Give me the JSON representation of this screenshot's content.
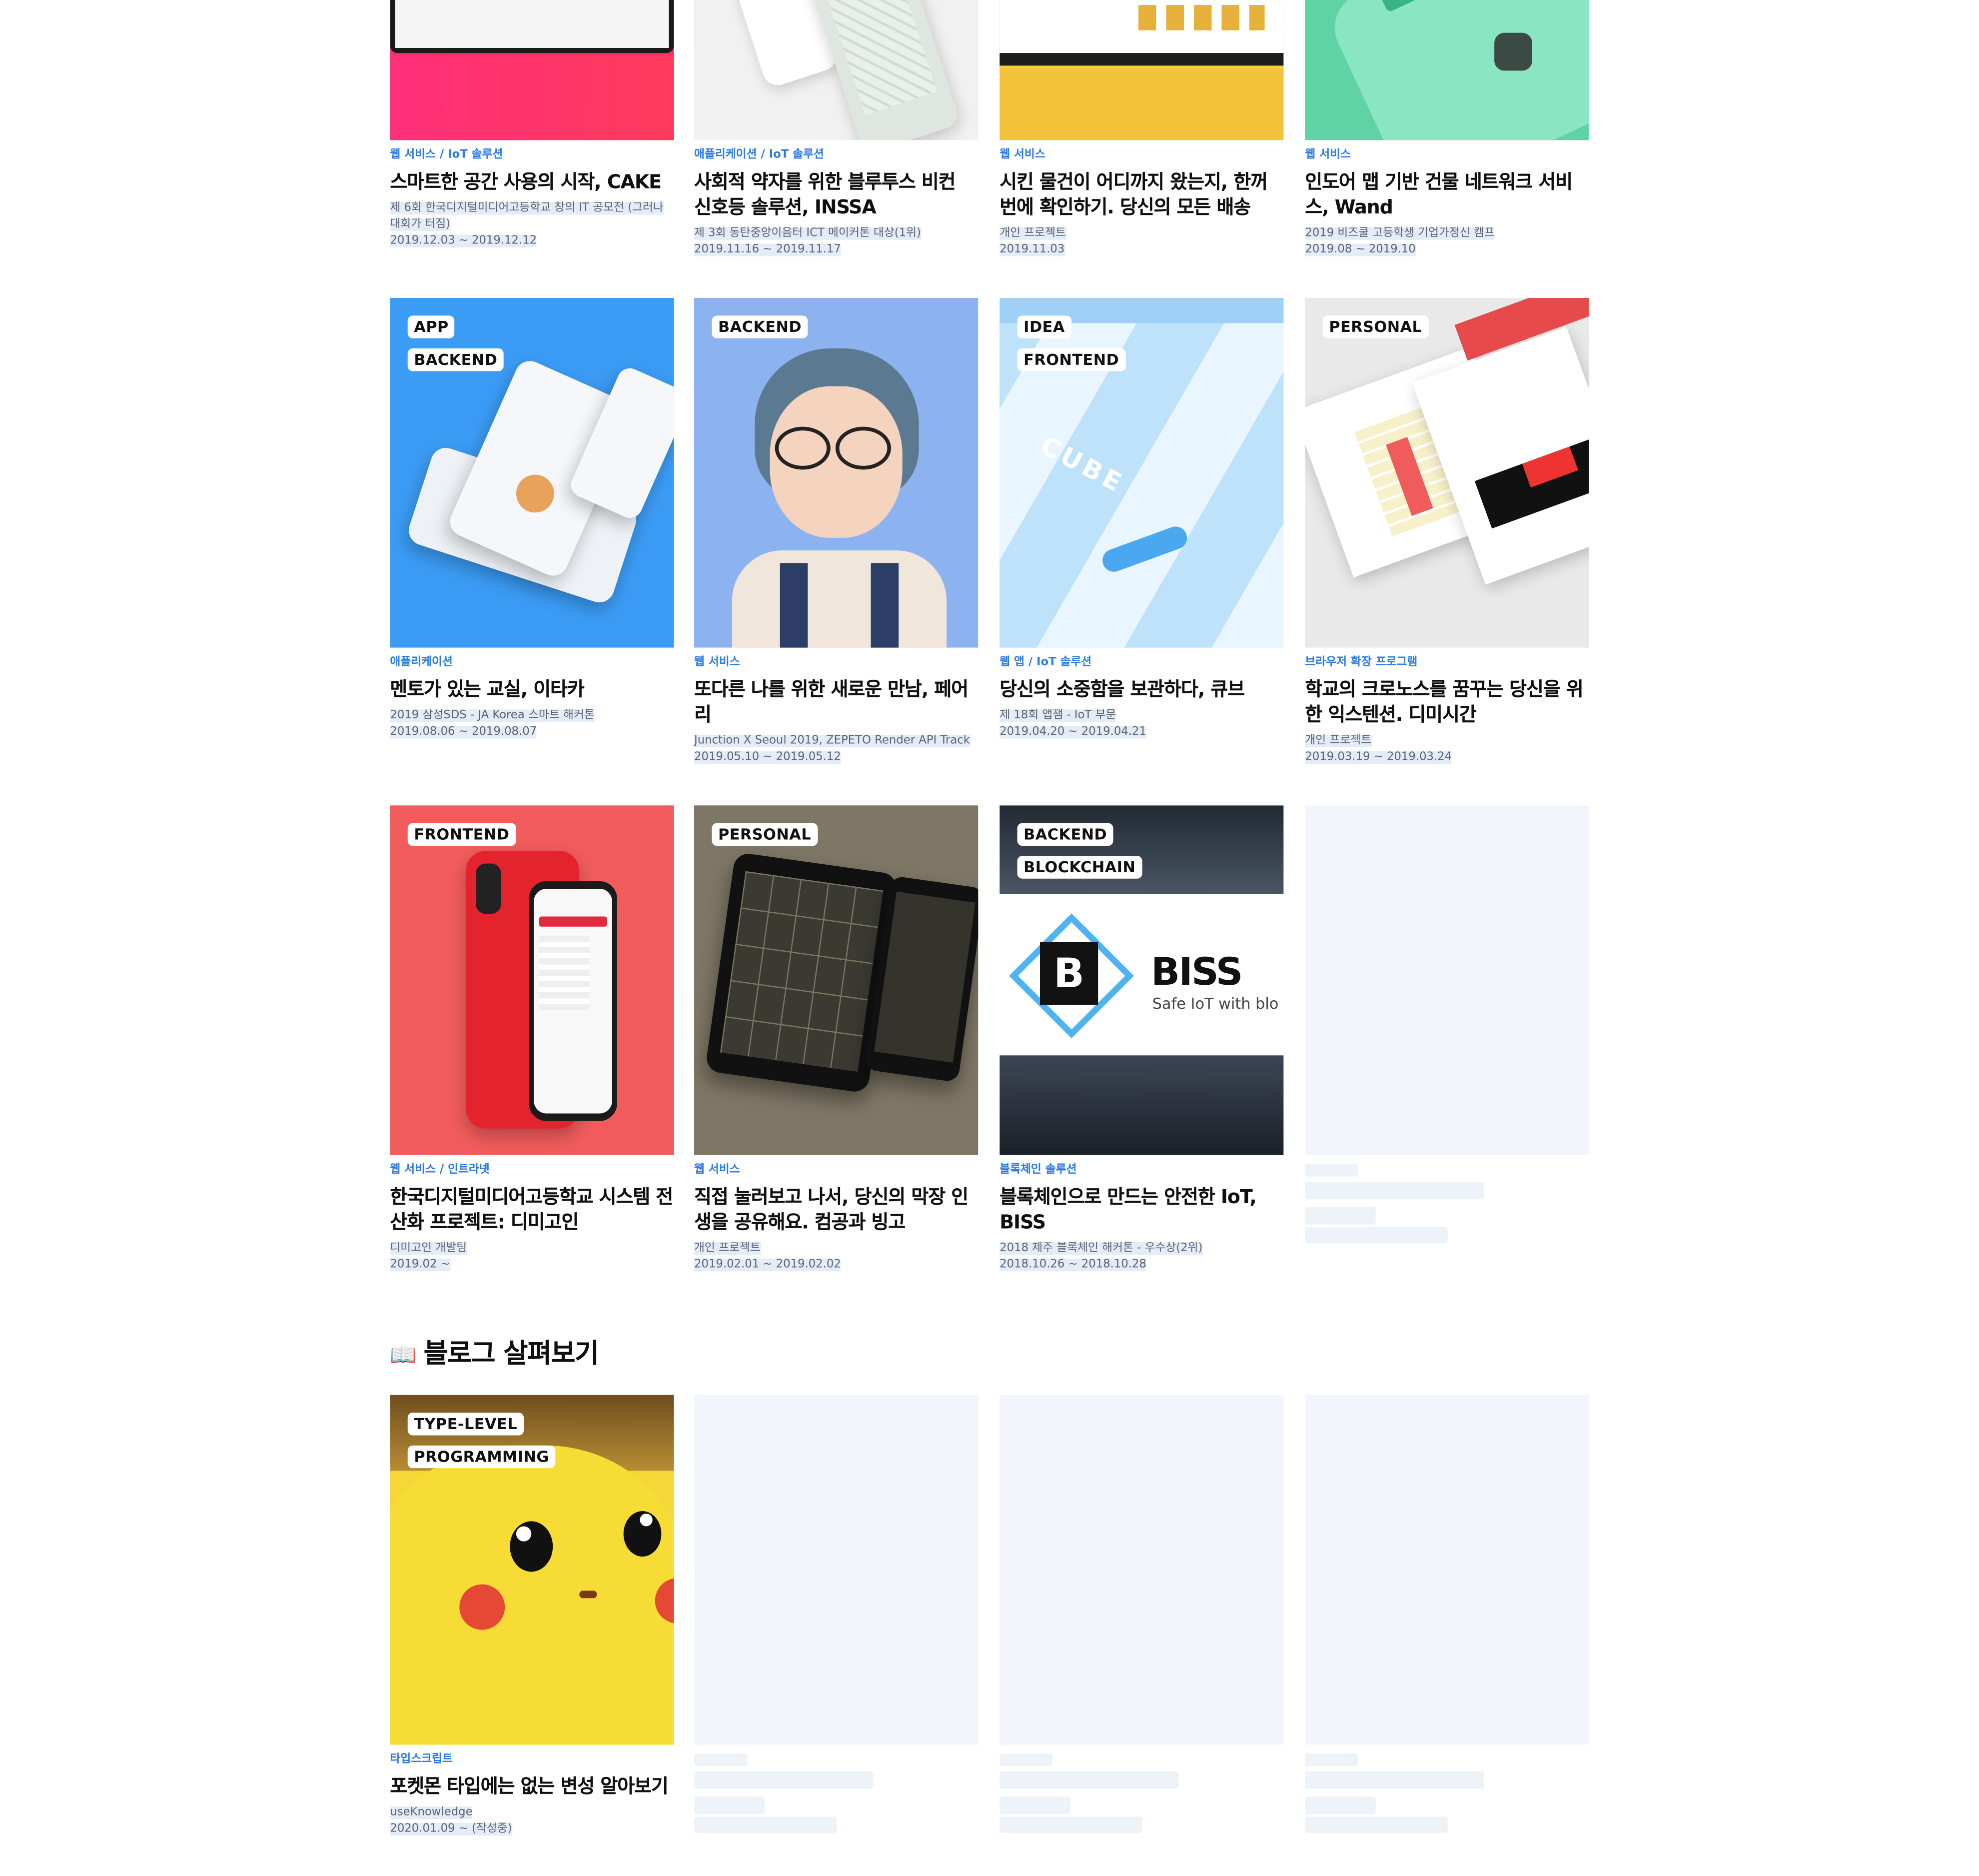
{
  "projects": [
    {
      "category": "웹 서비스 / IoT 솔루션",
      "title": "스마트한 공간 사용의 시작, CAKE",
      "subtitle": "제 6회 한국디지털미디어고등학교 창의 IT 공모전 (그러나 대회가 터짐)",
      "date": "2019.12.03 ~ 2019.12.12",
      "tags": []
    },
    {
      "category": "애플리케이션 / IoT 솔루션",
      "title": "사회적 약자를 위한 블루투스 비컨 신호등 솔루션, INSSA",
      "subtitle": "제 3회 동탄중앙이음터 ICT 메이커톤 대상(1위)",
      "date": "2019.11.16 ~ 2019.11.17",
      "tags": []
    },
    {
      "category": "웹 서비스",
      "title": "시킨 물건이 어디까지 왔는지, 한꺼번에 확인하기. 당신의 모든 배송",
      "subtitle": "개인 프로젝트",
      "date": "2019.11.03",
      "tags": []
    },
    {
      "category": "웹 서비스",
      "title": "인도어 맵 기반 건물 네트워크 서비스, Wand",
      "subtitle": "2019 비즈쿨 고등학생 기업가정신 캠프",
      "date": "2019.08 ~ 2019.10",
      "tags": []
    },
    {
      "category": "애플리케이션",
      "title": "멘토가 있는 교실, 이타카",
      "subtitle": "2019 삼성SDS - JA Korea 스마트 해커톤",
      "date": "2019.08.06 ~ 2019.08.07",
      "tags": [
        "APP",
        "BACKEND"
      ]
    },
    {
      "category": "웹 서비스",
      "title": "또다른 나를 위한 새로운 만남, 페어리",
      "subtitle": "Junction X Seoul 2019, ZEPETO Render API Track",
      "date": "2019.05.10 ~ 2019.05.12",
      "tags": [
        "BACKEND"
      ]
    },
    {
      "category": "웹 앱 / IoT 솔루션",
      "title": "당신의 소중함을 보관하다, 큐브",
      "subtitle": "제 18회 앱잼 - IoT 부문",
      "date": "2019.04.20 ~ 2019.04.21",
      "tags": [
        "IDEA",
        "FRONTEND"
      ]
    },
    {
      "category": "브라우저 확장 프로그램",
      "title": "학교의 크로노스를 꿈꾸는 당신을 위한 익스텐션. 디미시간",
      "subtitle": "개인 프로젝트",
      "date": "2019.03.19 ~ 2019.03.24",
      "tags": [
        "PERSONAL"
      ]
    },
    {
      "category": "웹 서비스 / 인트라넷",
      "title": "한국디지털미디어고등학교 시스템 전산화 프로젝트: 디미고인",
      "subtitle": "디미고인 개발팀",
      "date": "2019.02 ~",
      "tags": [
        "FRONTEND"
      ]
    },
    {
      "category": "웹 서비스",
      "title": "직접 눌러보고 나서, 당신의 막장 인생을 공유해요. 컴공과 빙고",
      "subtitle": "개인 프로젝트",
      "date": "2019.02.01 ~ 2019.02.02",
      "tags": [
        "PERSONAL"
      ]
    },
    {
      "category": "블록체인 솔루션",
      "title": "블록체인으로 만드는 안전한 IoT, BISS",
      "subtitle": "2018 제주 블록체인 해커톤 - 우수상(2위)",
      "date": "2018.10.26 ~ 2018.10.28",
      "tags": [
        "BACKEND",
        "BLOCKCHAIN"
      ]
    }
  ],
  "thumb_text": {
    "biss_name": "BISS",
    "biss_tagline": "Safe IoT with blo",
    "cube_name": "CUBE"
  },
  "blog_section": {
    "emoji": "📖",
    "title": "블로그 살펴보기",
    "post": {
      "category": "타입스크립트",
      "title": "포켓몬 타입에는 없는 변성 알아보기",
      "subtitle": "useKnowledge",
      "date": "2020.01.09 ~ (작성중)",
      "tags": [
        "TYPE-LEVEL",
        "PROGRAMMING"
      ]
    }
  },
  "colors": {
    "accent": "#2f7de1",
    "text": "#0f0f10",
    "muted": "#5b6470",
    "placeholder": "#f2f6fc"
  }
}
